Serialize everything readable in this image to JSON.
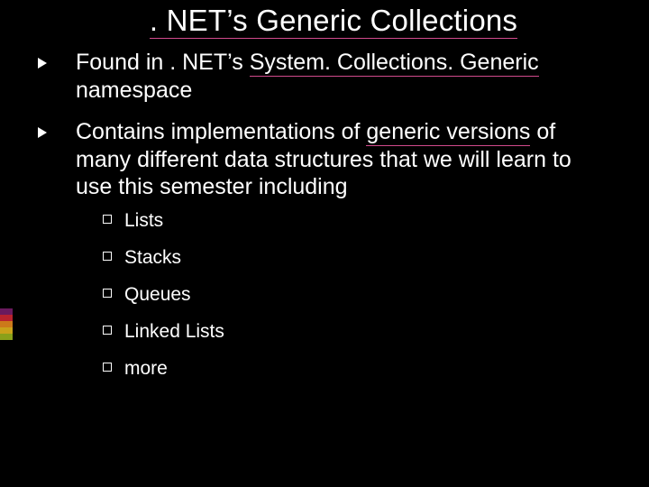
{
  "accent_colors": [
    "#6a1a5e",
    "#b8222e",
    "#cc7a1a",
    "#c9a21a",
    "#8aa01a"
  ],
  "title": ". NET’s Generic Collections",
  "bullet1_pre": "Found in . NET’s ",
  "bullet1_ul": "System. Collections. Generic",
  "bullet1_post": " namespace",
  "bullet2_pre": "Contains implementations of ",
  "bullet2_ul": "generic versions",
  "bullet2_post": " of many different data structures that we will learn to use this semester including",
  "sub": {
    "0": "Lists",
    "1": "Stacks",
    "2": "Queues",
    "3": "Linked Lists",
    "4": "more"
  }
}
